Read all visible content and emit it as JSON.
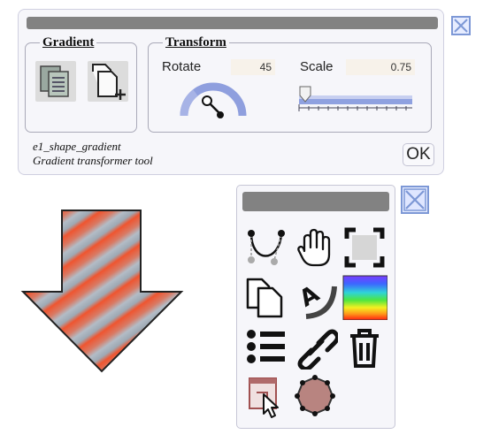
{
  "dialog": {
    "gradient_legend": "Gradient",
    "transform_legend": "Transform",
    "rotate_label": "Rotate",
    "rotate_value": "45",
    "scale_label": "Scale",
    "scale_value": "0.75",
    "desc_line1": "e1_shape_gradient",
    "desc_line2": "Gradient transformer tool",
    "ok_label": "OK"
  },
  "icons": {
    "dialog_close": "close-icon",
    "palette_close": "close-icon",
    "copy_gradient": "copy-gradient-icon",
    "new_gradient": "new-document-icon",
    "rotate_dial": "dial-icon",
    "scale_slider": "slider-icon",
    "tools": [
      "bezier-curve-icon",
      "hand-icon",
      "fit-to-view-icon",
      "copy-icon",
      "text-on-path-icon",
      "color-spectrum-icon",
      "list-icon",
      "link-icon",
      "trash-icon",
      "select-window-icon",
      "polygon-icon"
    ]
  },
  "colors": {
    "titlebar": "#828282",
    "stripe_orange": "#ef5530",
    "stripe_gray": "#b3bcc6",
    "slider_blue": "#7c8fd8",
    "close_border": "#7d98d6"
  }
}
